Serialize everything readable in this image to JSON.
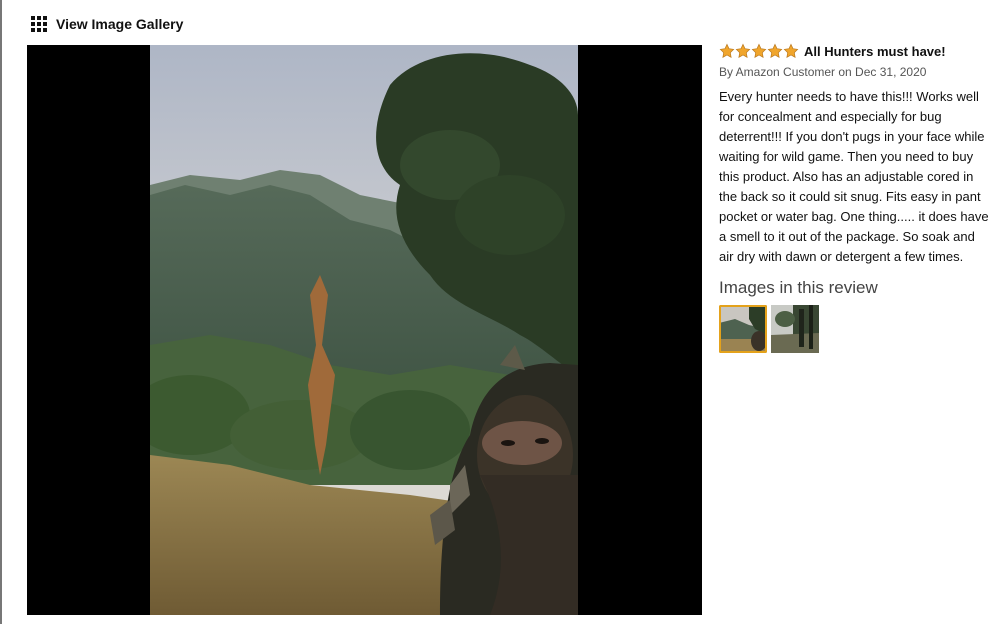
{
  "gallery": {
    "label": "View Image Gallery",
    "icon": "grid-icon"
  },
  "review": {
    "rating": 5,
    "rating_max": 5,
    "star_color": "#f0a52c",
    "title": "All Hunters must have!",
    "byline": "By Amazon Customer on Dec 31, 2020",
    "body": "Every hunter needs to have this!!! Works well for concealment and especially for bug deterrent!!! If you don't pugs in your face while waiting for wild game. Then you need to buy this product. Also has an adjustable cored in the back so it could sit snug. Fits easy in pant pocket or water bag. One thing..... it does have a smell to it out of the package. So soak and air dry with dawn or detergent a few times.",
    "images_heading": "Images in this review",
    "thumbnails": [
      {
        "name": "thumbnail-1",
        "selected": true
      },
      {
        "name": "thumbnail-2",
        "selected": false
      }
    ]
  },
  "colors": {
    "selected_outline": "#e4a21b",
    "viewer_background": "#000000"
  }
}
